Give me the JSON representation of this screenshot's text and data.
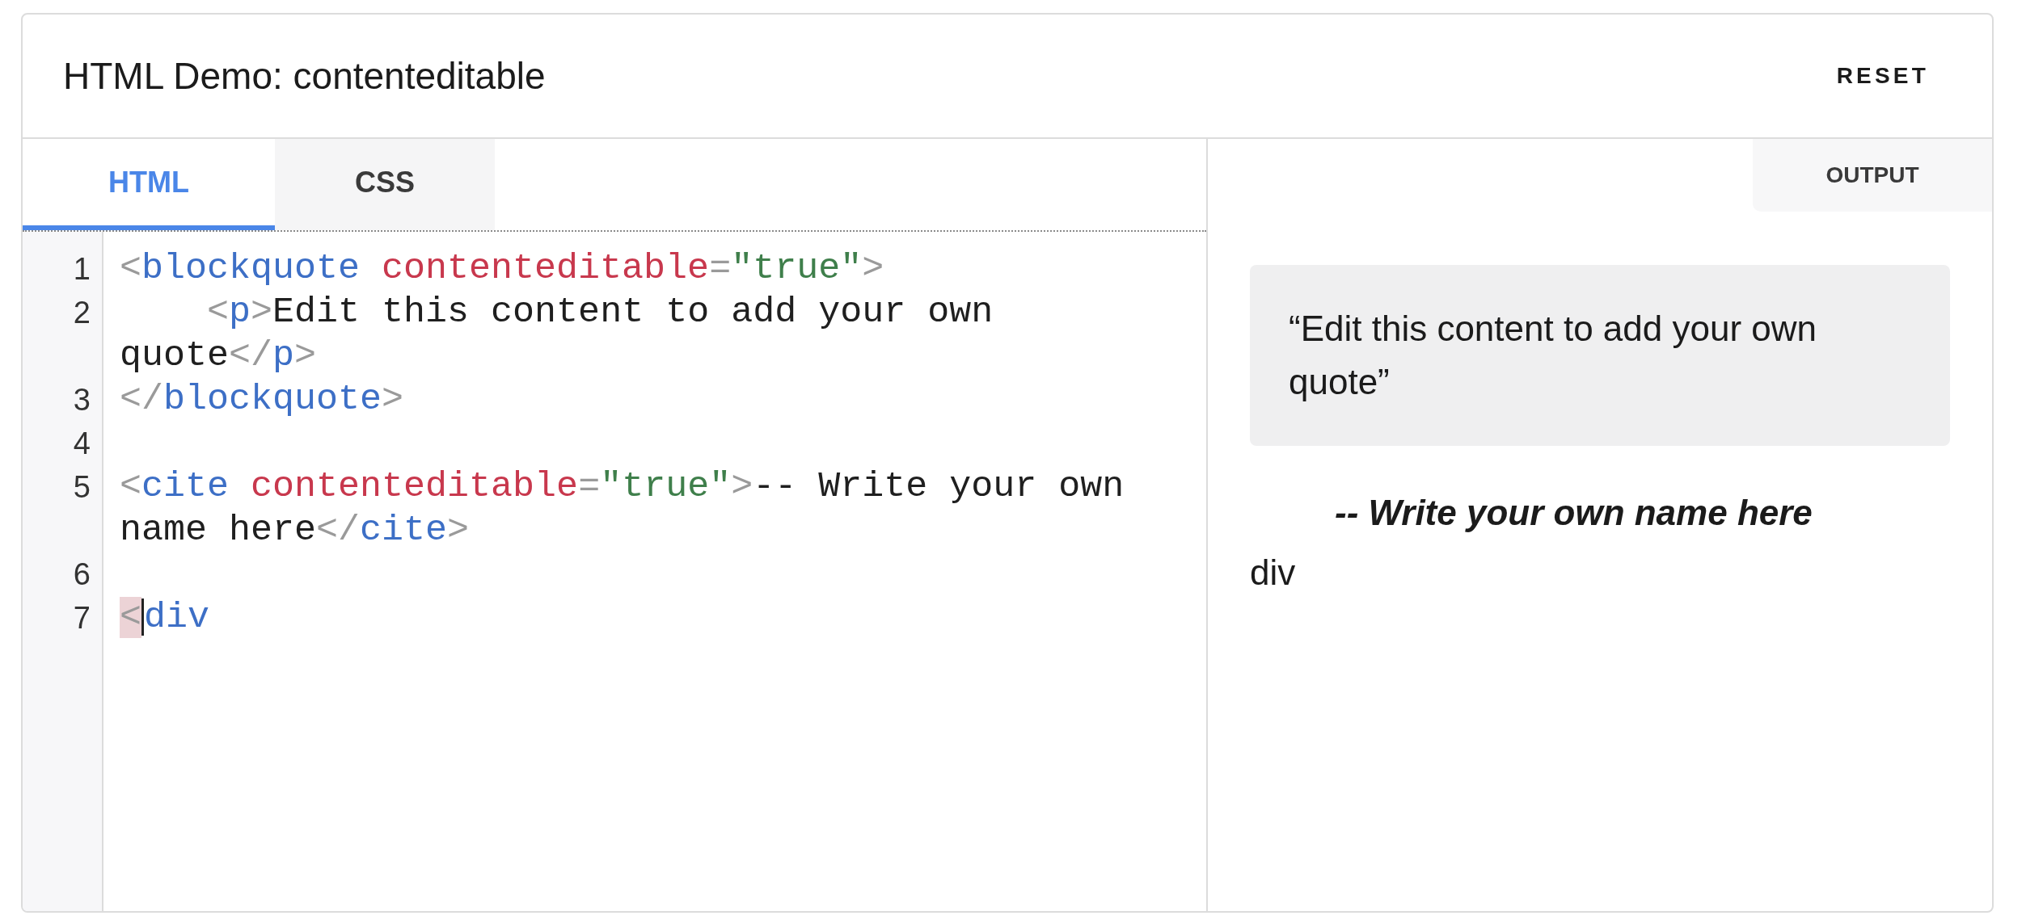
{
  "header": {
    "title": "HTML Demo: contenteditable",
    "reset": "RESET"
  },
  "tabs": [
    {
      "label": "HTML",
      "selected": true
    },
    {
      "label": "CSS",
      "selected": false
    }
  ],
  "code_lines": [
    {
      "number": "1",
      "tokens": [
        {
          "kind": "punct",
          "text": "<"
        },
        {
          "kind": "tag",
          "text": "blockquote"
        },
        {
          "kind": "attr",
          "text": "contenteditable",
          "space_before": true
        },
        {
          "kind": "punct",
          "text": "="
        },
        {
          "kind": "value",
          "text": "\"true\""
        },
        {
          "kind": "punct",
          "text": ">"
        }
      ]
    },
    {
      "number": "2",
      "indented": true,
      "tokens": [
        {
          "kind": "punct",
          "text": "<"
        },
        {
          "kind": "tag",
          "text": "p"
        },
        {
          "kind": "punct",
          "text": ">"
        },
        {
          "kind": "text",
          "text": "Edit this content to add your own quote"
        },
        {
          "kind": "punct",
          "text": "</"
        },
        {
          "kind": "tag",
          "text": "p"
        },
        {
          "kind": "punct",
          "text": ">"
        }
      ]
    },
    {
      "number": "3",
      "tokens": [
        {
          "kind": "punct",
          "text": "</"
        },
        {
          "kind": "tag",
          "text": "blockquote"
        },
        {
          "kind": "punct",
          "text": ">"
        }
      ]
    },
    {
      "number": "4"
    },
    {
      "number": "5",
      "tokens": [
        {
          "kind": "punct",
          "text": "<"
        },
        {
          "kind": "tag",
          "text": "cite"
        },
        {
          "kind": "attr",
          "text": "contenteditable",
          "space_before": true
        },
        {
          "kind": "punct",
          "text": "="
        },
        {
          "kind": "value",
          "text": "\"true\""
        },
        {
          "kind": "punct",
          "text": ">"
        },
        {
          "kind": "text",
          "text": "-- Write your own name here"
        },
        {
          "kind": "punct",
          "text": "</"
        },
        {
          "kind": "tag",
          "text": "cite"
        },
        {
          "kind": "punct",
          "text": ">"
        }
      ]
    },
    {
      "number": "6"
    },
    {
      "number": "7",
      "tokens": [
        {
          "kind": "punct",
          "text": "<",
          "highlight": true
        },
        {
          "kind": "tag",
          "text": "div"
        }
      ]
    }
  ],
  "output": {
    "tab": "OUTPUT",
    "quote": "“Edit this content to add your own quote”",
    "cite": "-- Write your own name here",
    "text": "div"
  }
}
